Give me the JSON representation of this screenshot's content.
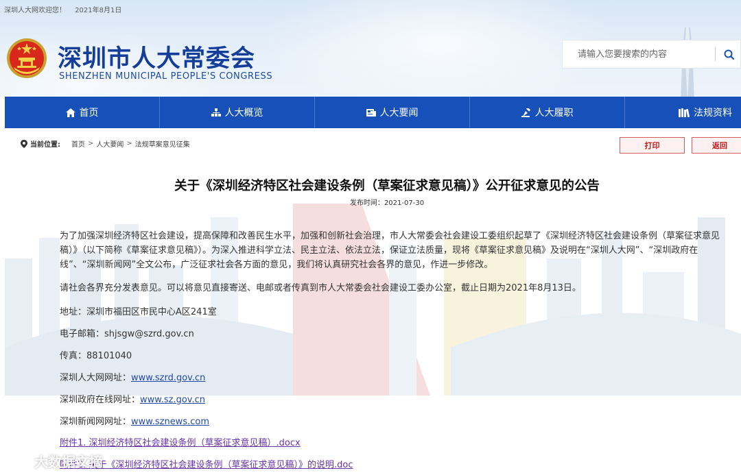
{
  "topbar": {
    "welcome": "深圳人大网欢迎您！",
    "date": "2021年8月1日"
  },
  "header": {
    "title": "深圳市人大常委会",
    "subtitle": "SHENZHEN MUNICIPAL PEOPLE'S CONGRESS",
    "search_placeholder": "请输入您要搜索的内容"
  },
  "nav": {
    "items": [
      {
        "label": "首页",
        "icon": "home-icon"
      },
      {
        "label": "人大概览",
        "icon": "organization-icon"
      },
      {
        "label": "人大要闻",
        "icon": "news-icon"
      },
      {
        "label": "人大履职",
        "icon": "duty-icon"
      },
      {
        "label": "法规资料",
        "icon": "books-icon"
      }
    ]
  },
  "breadcrumb": {
    "label": "当前位置:",
    "items": [
      "首页",
      "人大要闻",
      "法规草案意见征集"
    ]
  },
  "actions": {
    "print_label": "打印",
    "back_label": "返回"
  },
  "article": {
    "title": "关于《深圳经济特区社会建设条例（草案征求意见稿）》公开征求意见的公告",
    "pubdate_label": "发布时间：",
    "pubdate": "2021-07-30",
    "para1": "为了加强深圳经济特区社会建设，提高保障和改善民生水平，加强和创新社会治理，市人大常委会社会建设工委组织起草了《深圳经济特区社会建设条例（草案征求意见稿）》（以下简称《草案征求意见稿》）。为深入推进科学立法、民主立法、依法立法，保证立法质量，现将《草案征求意见稿》及说明在“深圳人大网”、“深圳政府在线”、“深圳新闻网”全文公布，广泛征求社会各方面的意见，我们将认真研究社会各界的意见，作进一步修改。",
    "para2": "请社会各界充分发表意见。可以将意见直接寄送、电邮或者传真到市人大常委会社会建设工委办公室，截止日期为2021年8月13日。",
    "address_label": "地址：",
    "address": "深圳市福田区市民中心A区241室",
    "email_label": "电子邮箱：",
    "email": "shjsgw@szrd.gov.cn",
    "fax_label": "传真：",
    "fax": "88101040",
    "link1_label": "深圳人大网网址：",
    "link1": "www.szrd.gov.cn",
    "link2_label": "深圳政府在线网址：",
    "link2": "www.sz.gov.cn",
    "link3_label": "深圳新闻网网址：",
    "link3": "www.sznews.com",
    "attachment1": "附件1. 深圳经济特区社会建设条例（草案征求意见稿）.docx",
    "attachment2": "附件2. 关于《深圳经济特区社会建设条例（草案征求意见稿）》的说明.doc"
  },
  "watermark": {
    "text": "大数据文摘"
  },
  "colors": {
    "nav_bg": "#1750b9",
    "title_blue": "#153e9a",
    "button_red": "#c01b1b",
    "link_blue": "#2349a8"
  }
}
